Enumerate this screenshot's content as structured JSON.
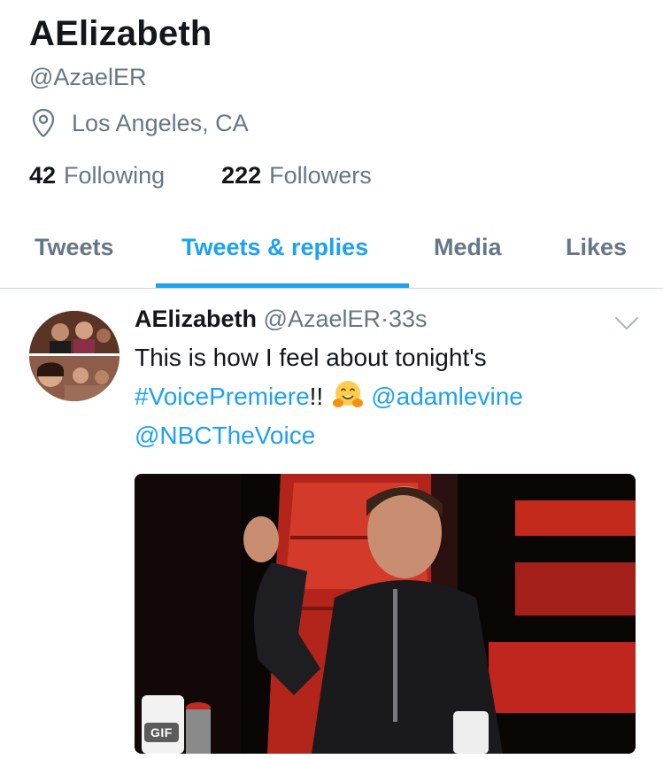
{
  "profile": {
    "name": "AElizabeth",
    "handle": "@AzaelER",
    "location": "Los Angeles, CA",
    "following_count": "42",
    "following_label": "Following",
    "followers_count": "222",
    "followers_label": "Followers"
  },
  "tabs": [
    {
      "label": "Tweets",
      "active": false
    },
    {
      "label": "Tweets & replies",
      "active": true
    },
    {
      "label": "Media",
      "active": false
    },
    {
      "label": "Likes",
      "active": false
    }
  ],
  "tweet": {
    "author": "AElizabeth",
    "handle": "@AzaelER",
    "separator": "·",
    "time": "33s",
    "text_plain": "This is how I feel about tonight's",
    "hashtag": "#VoicePremiere",
    "exclaim": "!!",
    "emoji": "hugging-face-emoji",
    "mention1": "@adamlevine",
    "mention2": "@NBCTheVoice",
    "media_badge": "GIF"
  },
  "colors": {
    "accent": "#1da1f2",
    "text_primary": "#14171a",
    "text_secondary": "#657786",
    "divider": "#ccd6dd"
  }
}
